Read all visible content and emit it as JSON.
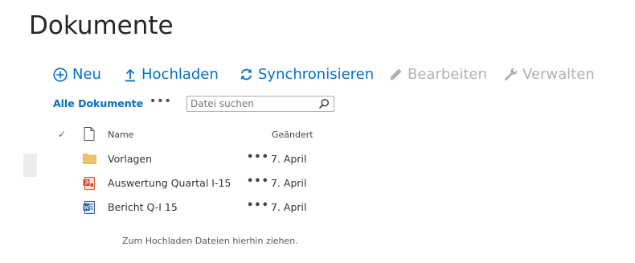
{
  "page_title": "Dokumente",
  "commands": {
    "new": "Neu",
    "upload": "Hochladen",
    "sync": "Synchronisieren",
    "edit": "Bearbeiten",
    "manage": "Verwalten"
  },
  "view": {
    "label": "Alle Dokumente",
    "more": "•••",
    "search_placeholder": "Datei suchen"
  },
  "columns": {
    "name": "Name",
    "modified": "Geändert"
  },
  "items": [
    {
      "name": "Vorlagen",
      "date": "7. April",
      "icon": "folder-icon"
    },
    {
      "name": "Auswertung Quartal I-15",
      "date": "7. April",
      "icon": "powerpoint-file-icon"
    },
    {
      "name": "Bericht Q-I 15",
      "date": "7. April",
      "icon": "word-file-icon"
    }
  ],
  "row_menu": "•••",
  "drop_hint": "Zum Hochladen Dateien hierhin ziehen.",
  "colors": {
    "accent": "#0072c6",
    "disabled": "#b1b1b1",
    "folder": "#f0c26b"
  }
}
